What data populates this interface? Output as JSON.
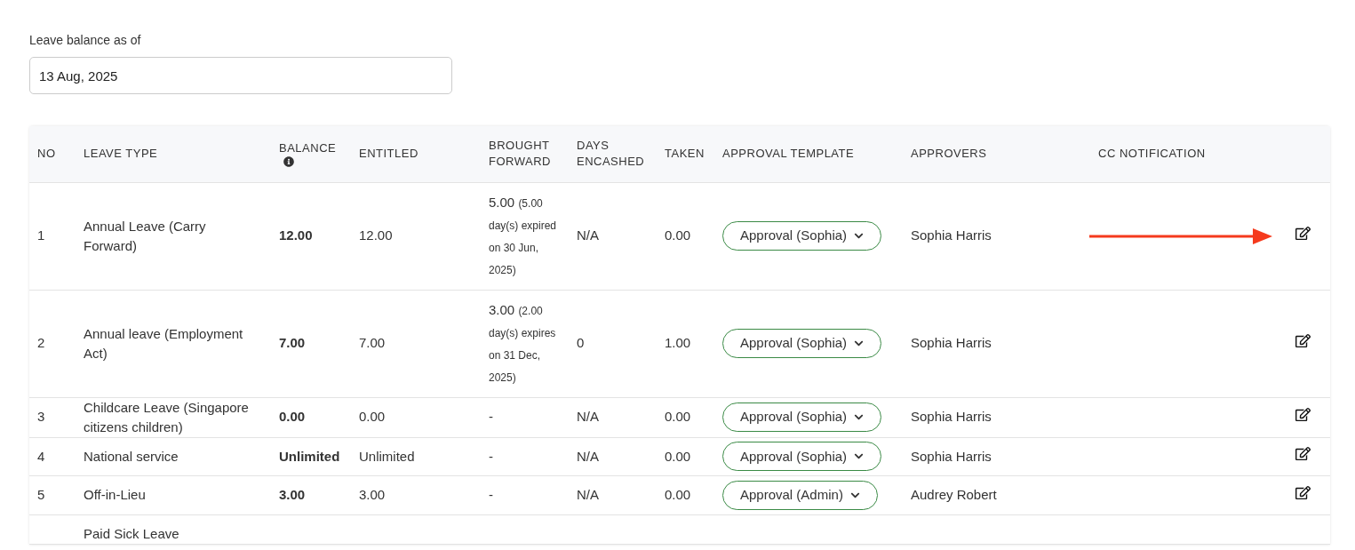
{
  "balance_date": {
    "label": "Leave balance as of",
    "value": "13 Aug, 2025"
  },
  "table": {
    "columns": [
      "NO",
      "LEAVE TYPE",
      "BALANCE",
      "ENTITLED",
      "BROUGHT FORWARD",
      "DAYS ENCASHED",
      "TAKEN",
      "APPROVAL TEMPLATE",
      "APPROVERS",
      "CC NOTIFICATION"
    ],
    "rows": [
      {
        "no": "1",
        "leave_type": "Annual Leave (Carry Forward)",
        "balance": "12.00",
        "entitled": "12.00",
        "brought_forward": "5.00",
        "brought_forward_note": "(5.00 day(s) expired on 30 Jun, 2025)",
        "days_encashed": "N/A",
        "taken": "0.00",
        "approval_template": "Approval (Sophia)",
        "approvers": "Sophia Harris",
        "highlighted": true
      },
      {
        "no": "2",
        "leave_type": "Annual leave (Employment Act)",
        "balance": "7.00",
        "entitled": "7.00",
        "brought_forward": "3.00",
        "brought_forward_note": "(2.00 day(s) expires on 31 Dec, 2025)",
        "days_encashed": "0",
        "taken": "1.00",
        "approval_template": "Approval (Sophia)",
        "approvers": "Sophia Harris",
        "highlighted": false
      },
      {
        "no": "3",
        "leave_type": "Childcare Leave (Singapore citizens children)",
        "balance": "0.00",
        "entitled": "0.00",
        "brought_forward": "-",
        "days_encashed": "N/A",
        "taken": "0.00",
        "approval_template": "Approval (Sophia)",
        "approvers": "Sophia Harris",
        "highlighted": false
      },
      {
        "no": "4",
        "leave_type": "National service",
        "balance": "Unlimited",
        "entitled": "Unlimited",
        "brought_forward": "-",
        "days_encashed": "N/A",
        "taken": "0.00",
        "approval_template": "Approval (Sophia)",
        "approvers": "Sophia Harris",
        "highlighted": false
      },
      {
        "no": "5",
        "leave_type": "Off-in-Lieu",
        "balance": "3.00",
        "entitled": "3.00",
        "brought_forward": "-",
        "days_encashed": "N/A",
        "taken": "0.00",
        "approval_template": "Approval (Admin)",
        "approvers": "Audrey Robert",
        "highlighted": false
      },
      {
        "leave_type": "Paid Sick Leave",
        "highlighted": false
      }
    ]
  }
}
